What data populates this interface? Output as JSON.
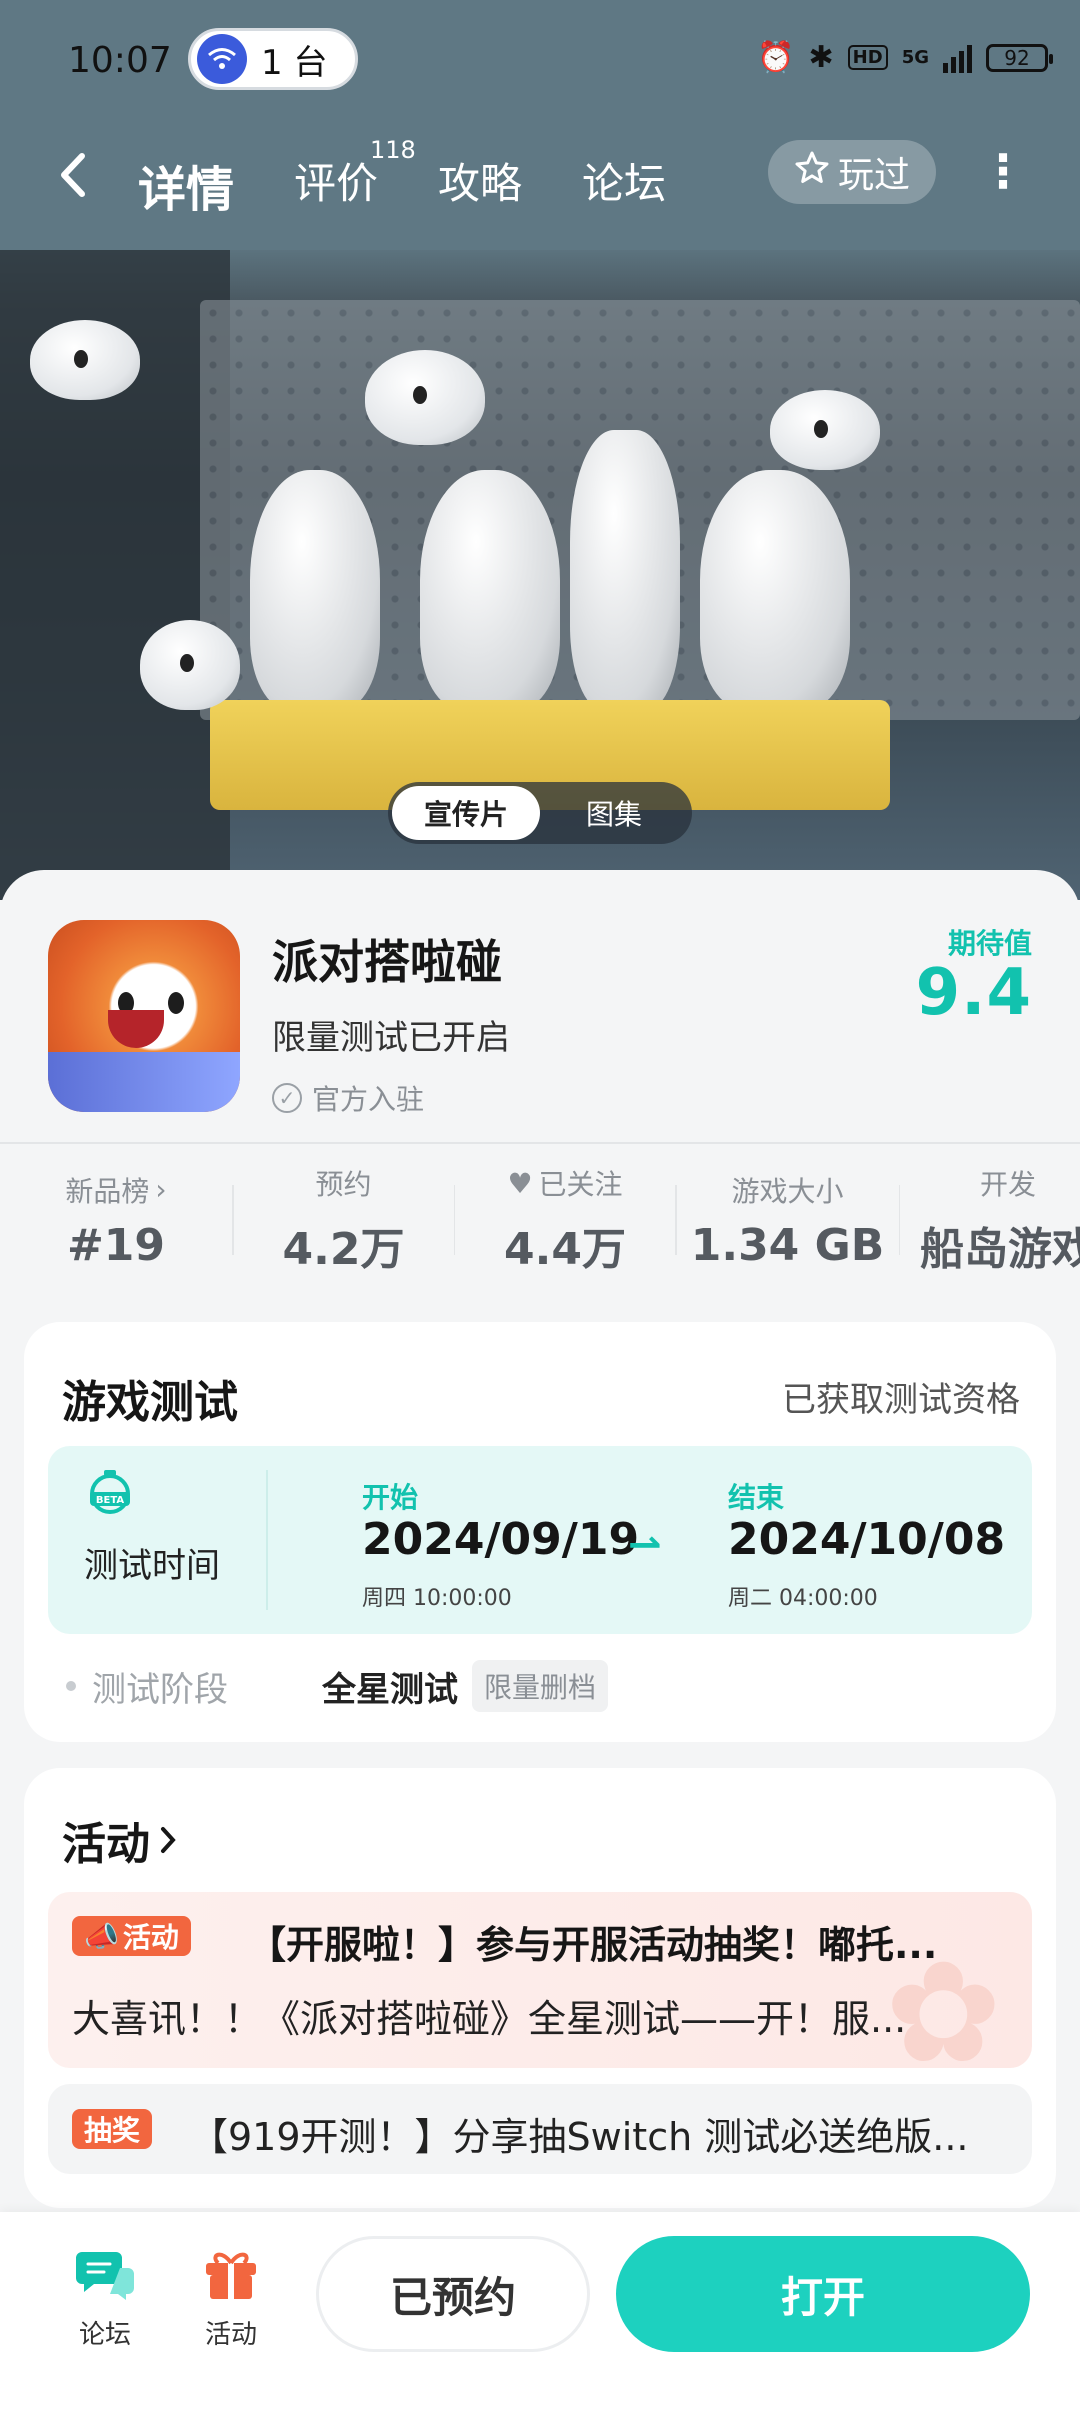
{
  "status_bar": {
    "time": "10:07",
    "device_count": "1 台",
    "battery": "92",
    "network": "5G"
  },
  "nav": {
    "tabs": [
      "详情",
      "评价",
      "攻略",
      "论坛"
    ],
    "review_count": "118",
    "played_label": "玩过"
  },
  "media": {
    "tabs": [
      "宣传片",
      "图集"
    ],
    "selected": "宣传片"
  },
  "game": {
    "title": "派对搭啦碰",
    "subtitle": "限量测试已开启",
    "official": "官方入驻",
    "expect_label": "期待值",
    "expect_value": "9.4"
  },
  "stats": [
    {
      "label": "新品榜",
      "value": "#19"
    },
    {
      "label": "预约",
      "value": "4.2万"
    },
    {
      "label": "已关注",
      "value": "4.4万"
    },
    {
      "label": "游戏大小",
      "value": "1.34 GB"
    },
    {
      "label": "开发",
      "value": "船岛游戏"
    }
  ],
  "test": {
    "title": "游戏测试",
    "status": "已获取测试资格",
    "beta": "BETA",
    "time_label": "测试时间",
    "start_label": "开始",
    "start_date": "2024/09/19",
    "start_time": "周四  10:00:00",
    "end_label": "结束",
    "end_date": "2024/10/08",
    "end_time": "周二  04:00:00",
    "phase_label": "测试阶段",
    "phase_value": "全星测试",
    "phase_tag": "限量删档"
  },
  "activities": {
    "title": "活动",
    "items": [
      {
        "tag": "活动",
        "headline": "【开服啦！】参与开服活动抽奖！嘟托...",
        "body": "大喜讯！！《派对搭啦碰》全星测试——开！服..."
      },
      {
        "tag": "抽奖",
        "headline": "【919开测！】分享抽Switch 测试必送绝版..."
      }
    ]
  },
  "bottom": {
    "forum_label": "论坛",
    "activity_label": "活动",
    "reserved_label": "已预约",
    "open_label": "打开"
  },
  "colors": {
    "accent": "#1dd1bf",
    "tag_orange": "#f2663f"
  }
}
